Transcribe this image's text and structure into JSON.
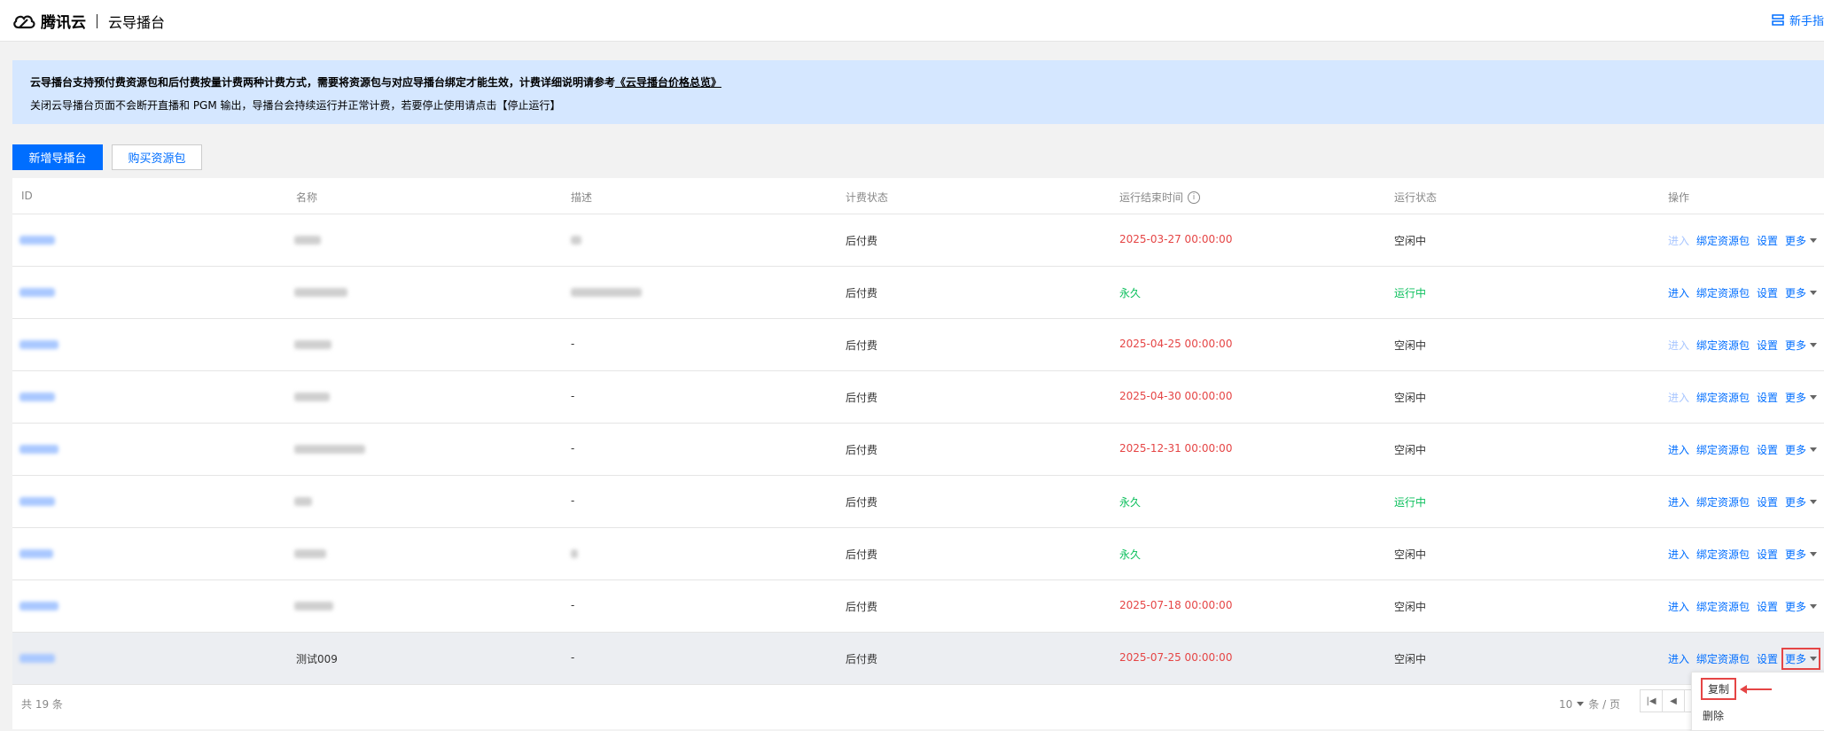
{
  "header": {
    "brand": "腾讯云",
    "product": "云导播台",
    "guide_label": "新手指"
  },
  "notice": {
    "line1_prefix": "云导播台支持预付费资源包和后付费按量计费两种计费方式，需要将资源包与对应导播台绑定才能生效，计费详细说明请参考",
    "line1_link": "《云导播台价格总览》",
    "line2": "关闭云导播台页面不会断开直播和 PGM 输出，导播台会持续运行并正常计费，若要停止使用请点击【停止运行】"
  },
  "toolbar": {
    "new_label": "新增导播台",
    "buy_label": "购买资源包"
  },
  "table": {
    "columns": [
      "ID",
      "名称",
      "描述",
      "计费状态",
      "运行结束时间",
      "运行状态",
      "操作"
    ],
    "rows": [
      {
        "name": "",
        "desc": "",
        "billing": "后付费",
        "end_time": "2025-03-27 00:00:00",
        "end_color": "red",
        "status": "空闲中",
        "status_color": "normal",
        "enter_disabled": true
      },
      {
        "name": "",
        "desc": "",
        "billing": "后付费",
        "end_time": "永久",
        "end_color": "green",
        "status": "运行中",
        "status_color": "green",
        "enter_disabled": false
      },
      {
        "name": "",
        "desc": "-",
        "billing": "后付费",
        "end_time": "2025-04-25 00:00:00",
        "end_color": "red",
        "status": "空闲中",
        "status_color": "normal",
        "enter_disabled": true
      },
      {
        "name": "",
        "desc": "-",
        "billing": "后付费",
        "end_time": "2025-04-30 00:00:00",
        "end_color": "red",
        "status": "空闲中",
        "status_color": "normal",
        "enter_disabled": true
      },
      {
        "name": "",
        "desc": "-",
        "billing": "后付费",
        "end_time": "2025-12-31 00:00:00",
        "end_color": "red",
        "status": "空闲中",
        "status_color": "normal",
        "enter_disabled": false
      },
      {
        "name": "",
        "desc": "-",
        "billing": "后付费",
        "end_time": "永久",
        "end_color": "green",
        "status": "运行中",
        "status_color": "green",
        "enter_disabled": false
      },
      {
        "name": "",
        "desc": "",
        "billing": "后付费",
        "end_time": "永久",
        "end_color": "green",
        "status": "空闲中",
        "status_color": "normal",
        "enter_disabled": false
      },
      {
        "name": "",
        "desc": "-",
        "billing": "后付费",
        "end_time": "2025-07-18 00:00:00",
        "end_color": "red",
        "status": "空闲中",
        "status_color": "normal",
        "enter_disabled": false
      },
      {
        "name": "测试009",
        "desc": "-",
        "billing": "后付费",
        "end_time": "2025-07-25 00:00:00",
        "end_color": "red",
        "status": "空闲中",
        "status_color": "normal",
        "enter_disabled": false
      }
    ],
    "ops": {
      "enter": "进入",
      "bind": "绑定资源包",
      "settings": "设置",
      "more": "更多"
    }
  },
  "footer": {
    "total": "共 19 条",
    "page_size": "10",
    "page_size_unit": "条 / 页"
  },
  "dropdown": {
    "copy": "复制",
    "delete": "删除"
  },
  "colors": {
    "primary": "#006eff",
    "red": "#e54545",
    "green": "#0abf5b"
  }
}
